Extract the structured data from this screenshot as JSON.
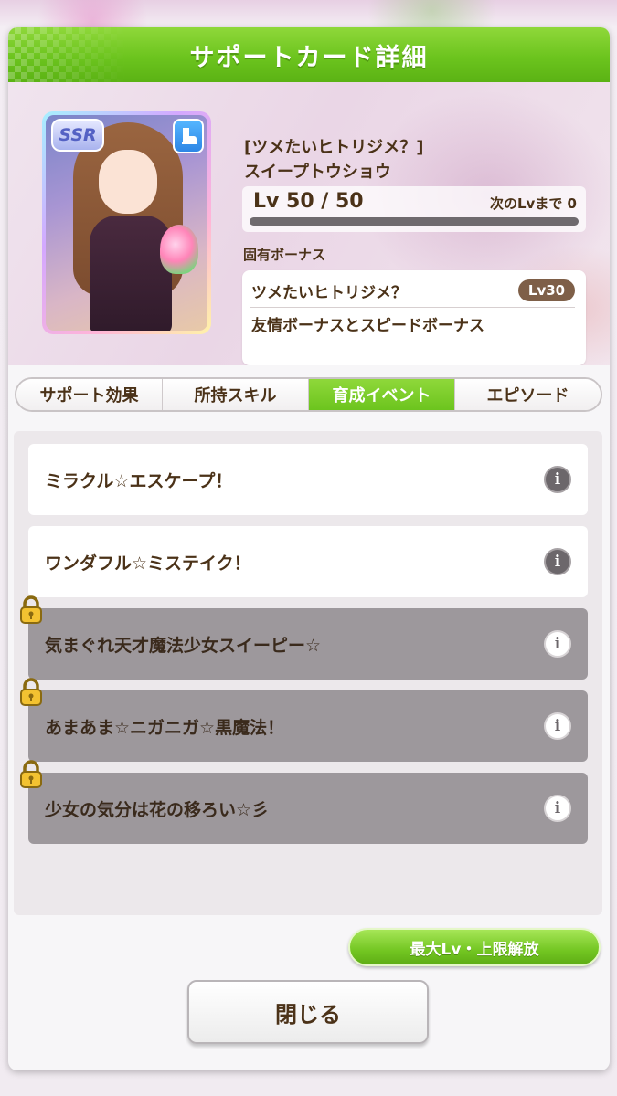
{
  "dialog": {
    "title": "サポートカード詳細"
  },
  "card": {
    "rarity": "SSR",
    "type_icon": "speed-boot-icon",
    "title": "[ツメたいヒトリジメ？]",
    "character": "スイープトウショウ",
    "level_text": "Lv 50 / 50",
    "next_level_text": "次のLvまで 0",
    "level_progress": 1.0
  },
  "unique_bonus": {
    "label": "固有ボーナス",
    "name": "ツメたいヒトリジメ？",
    "unlock_level": "Lv30",
    "description": "友情ボーナスとスピードボーナス"
  },
  "tabs": [
    {
      "label": "サポート効果",
      "active": false
    },
    {
      "label": "所持スキル",
      "active": false
    },
    {
      "label": "育成イベント",
      "active": true
    },
    {
      "label": "エピソード",
      "active": false
    }
  ],
  "events": [
    {
      "title": "ミラクル☆エスケープ！",
      "locked": false
    },
    {
      "title": "ワンダフル☆ミステイク！",
      "locked": false
    },
    {
      "title": "気まぐれ天才魔法少女スイーピー☆",
      "locked": true
    },
    {
      "title": "あまあま☆ニガニガ☆黒魔法！",
      "locked": true
    },
    {
      "title": "少女の気分は花の移ろい☆彡",
      "locked": true
    }
  ],
  "info_glyph": "i",
  "buttons": {
    "max_level_label": "最大Lv・上限解放",
    "close_label": "閉じる"
  },
  "colors": {
    "accent_green": "#6cc41e",
    "text_brown": "#4b3218",
    "locked_row": "#9d989c"
  }
}
